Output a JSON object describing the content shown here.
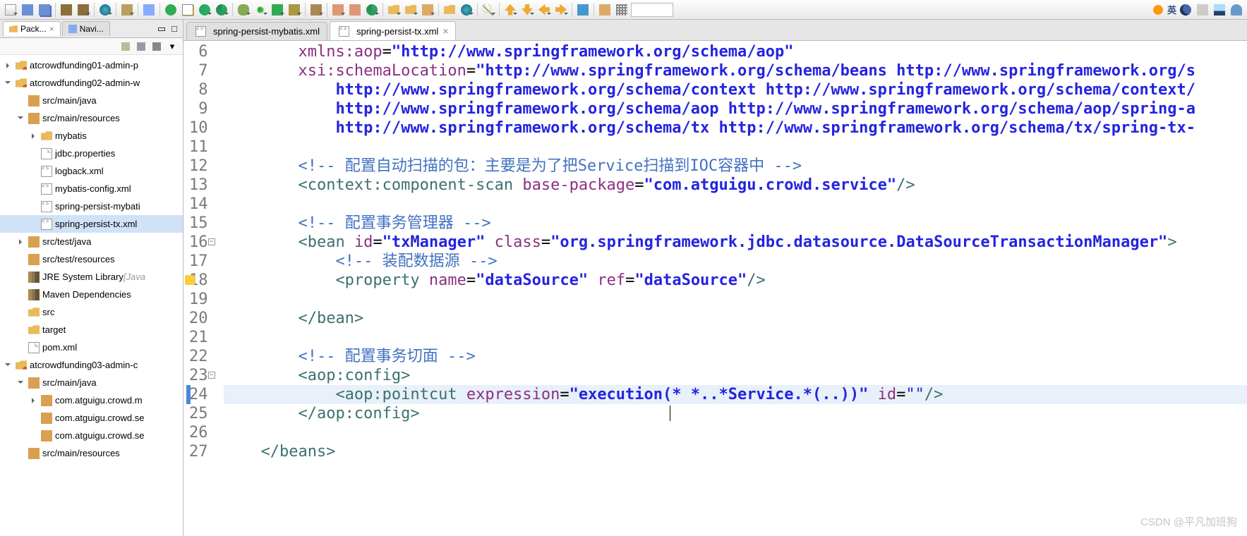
{
  "toolbar_right_text": "英",
  "sidebar": {
    "tabs": [
      {
        "label": "Pack...",
        "active": true
      },
      {
        "label": "Navi...",
        "active": false
      }
    ],
    "tree": [
      {
        "d": 0,
        "exp": "closed",
        "icon": "proj",
        "label": "atcrowdfunding01-admin-p"
      },
      {
        "d": 0,
        "exp": "open",
        "icon": "proj",
        "label": "atcrowdfunding02-admin-w"
      },
      {
        "d": 1,
        "exp": "none",
        "icon": "pkg",
        "label": "src/main/java"
      },
      {
        "d": 1,
        "exp": "open",
        "icon": "pkg",
        "label": "src/main/resources"
      },
      {
        "d": 2,
        "exp": "closed",
        "icon": "fold",
        "label": "mybatis"
      },
      {
        "d": 2,
        "exp": "none",
        "icon": "file",
        "label": "jdbc.properties"
      },
      {
        "d": 2,
        "exp": "none",
        "icon": "xml",
        "label": "logback.xml"
      },
      {
        "d": 2,
        "exp": "none",
        "icon": "xml",
        "label": "mybatis-config.xml"
      },
      {
        "d": 2,
        "exp": "none",
        "icon": "xml",
        "label": "spring-persist-mybati"
      },
      {
        "d": 2,
        "exp": "none",
        "icon": "xml",
        "label": "spring-persist-tx.xml",
        "sel": true
      },
      {
        "d": 1,
        "exp": "closed",
        "icon": "pkg",
        "label": "src/test/java"
      },
      {
        "d": 1,
        "exp": "none",
        "icon": "pkg",
        "label": "src/test/resources"
      },
      {
        "d": 1,
        "exp": "none",
        "icon": "lib",
        "label": "JRE System Library",
        "decor": " [Java"
      },
      {
        "d": 1,
        "exp": "none",
        "icon": "lib",
        "label": "Maven Dependencies"
      },
      {
        "d": 1,
        "exp": "none",
        "icon": "fold",
        "label": "src"
      },
      {
        "d": 1,
        "exp": "none",
        "icon": "fold",
        "label": "target"
      },
      {
        "d": 1,
        "exp": "none",
        "icon": "file",
        "label": "pom.xml"
      },
      {
        "d": 0,
        "exp": "open",
        "icon": "proj",
        "label": "atcrowdfunding03-admin-c"
      },
      {
        "d": 1,
        "exp": "open",
        "icon": "pkg",
        "label": "src/main/java"
      },
      {
        "d": 2,
        "exp": "closed",
        "icon": "pkg",
        "label": "com.atguigu.crowd.m"
      },
      {
        "d": 2,
        "exp": "none",
        "icon": "pkg",
        "label": "com.atguigu.crowd.se"
      },
      {
        "d": 2,
        "exp": "none",
        "icon": "pkg",
        "label": "com.atguigu.crowd.se"
      },
      {
        "d": 1,
        "exp": "none",
        "icon": "pkg",
        "label": "src/main/resources"
      }
    ]
  },
  "editor": {
    "tabs": [
      {
        "label": "spring-persist-mybatis.xml",
        "active": false
      },
      {
        "label": "spring-persist-tx.xml",
        "active": true
      }
    ],
    "startLine": 6,
    "lines": [
      {
        "n": 6,
        "seg": [
          {
            "c": "attr",
            "t": "        xmlns:aop"
          },
          {
            "c": "",
            "t": "="
          },
          {
            "c": "strb",
            "t": "\"http://www.springframework.org/schema/aop\""
          }
        ]
      },
      {
        "n": 7,
        "seg": [
          {
            "c": "attr",
            "t": "        xsi:schemaLocation"
          },
          {
            "c": "",
            "t": "="
          },
          {
            "c": "strb",
            "t": "\"http://www.springframework.org/schema/beans http://www.springframework.org/s"
          }
        ]
      },
      {
        "n": 8,
        "seg": [
          {
            "c": "strb",
            "t": "            http://www.springframework.org/schema/context http://www.springframework.org/schema/context/"
          }
        ]
      },
      {
        "n": 9,
        "seg": [
          {
            "c": "strb",
            "t": "            http://www.springframework.org/schema/aop http://www.springframework.org/schema/aop/spring-a"
          }
        ]
      },
      {
        "n": 10,
        "seg": [
          {
            "c": "strb",
            "t": "            http://www.springframework.org/schema/tx http://www.springframework.org/schema/tx/spring-tx-"
          }
        ]
      },
      {
        "n": 11,
        "seg": []
      },
      {
        "n": 12,
        "seg": [
          {
            "c": "cmt",
            "t": "        <!-- "
          },
          {
            "c": "cmt-txt",
            "t": "配置自动扫描的包：主要是为了把Service扫描到IOC容器中"
          },
          {
            "c": "cmt",
            "t": " -->"
          }
        ]
      },
      {
        "n": 13,
        "seg": [
          {
            "c": "tag",
            "t": "        <context:component-scan "
          },
          {
            "c": "attr",
            "t": "base-package"
          },
          {
            "c": "",
            "t": "="
          },
          {
            "c": "strb",
            "t": "\"com.atguigu.crowd.service\""
          },
          {
            "c": "tag",
            "t": "/>"
          }
        ]
      },
      {
        "n": 14,
        "seg": []
      },
      {
        "n": 15,
        "seg": [
          {
            "c": "cmt",
            "t": "        <!-- "
          },
          {
            "c": "cmt-txt",
            "t": "配置事务管理器"
          },
          {
            "c": "cmt",
            "t": " -->"
          }
        ]
      },
      {
        "n": 16,
        "fold": true,
        "seg": [
          {
            "c": "tag",
            "t": "        <bean "
          },
          {
            "c": "attr",
            "t": "id"
          },
          {
            "c": "",
            "t": "="
          },
          {
            "c": "strb",
            "t": "\"txManager\""
          },
          {
            "c": "tag",
            "t": " "
          },
          {
            "c": "attr",
            "t": "class"
          },
          {
            "c": "",
            "t": "="
          },
          {
            "c": "strb",
            "t": "\"org.springframework.jdbc.datasource.DataSourceTransactionManager\""
          },
          {
            "c": "tag",
            "t": ">"
          }
        ]
      },
      {
        "n": 17,
        "seg": [
          {
            "c": "cmt",
            "t": "            <!-- "
          },
          {
            "c": "cmt-txt",
            "t": "装配数据源"
          },
          {
            "c": "cmt",
            "t": " -->"
          }
        ]
      },
      {
        "n": 18,
        "warn": "y",
        "seg": [
          {
            "c": "tag",
            "t": "            <property "
          },
          {
            "c": "attr",
            "t": "name"
          },
          {
            "c": "",
            "t": "="
          },
          {
            "c": "strb",
            "t": "\"dataSource\""
          },
          {
            "c": "tag",
            "t": " "
          },
          {
            "c": "attr",
            "t": "ref"
          },
          {
            "c": "",
            "t": "="
          },
          {
            "c": "strb",
            "t": "\"dataSource\""
          },
          {
            "c": "tag",
            "t": "/>"
          }
        ]
      },
      {
        "n": 19,
        "seg": []
      },
      {
        "n": 20,
        "seg": [
          {
            "c": "tag",
            "t": "        </bean>"
          }
        ]
      },
      {
        "n": 21,
        "seg": []
      },
      {
        "n": 22,
        "seg": [
          {
            "c": "cmt",
            "t": "        <!-- "
          },
          {
            "c": "cmt-txt",
            "t": "配置事务切面"
          },
          {
            "c": "cmt",
            "t": " -->"
          }
        ]
      },
      {
        "n": 23,
        "fold": true,
        "seg": [
          {
            "c": "tag",
            "t": "        <aop:config>"
          }
        ]
      },
      {
        "n": 24,
        "cur": true,
        "hl": true,
        "seg": [
          {
            "c": "tag",
            "t": "            <aop:pointcut "
          },
          {
            "c": "attr",
            "t": "expression"
          },
          {
            "c": "",
            "t": "="
          },
          {
            "c": "strb",
            "t": "\"execution(* *..*Service.*(..))\""
          },
          {
            "c": "tag",
            "t": " "
          },
          {
            "c": "attr",
            "t": "id"
          },
          {
            "c": "",
            "t": "="
          },
          {
            "c": "str",
            "t": "\"\""
          },
          {
            "c": "tag",
            "t": "/>"
          }
        ]
      },
      {
        "n": 25,
        "seg": [
          {
            "c": "tag",
            "t": "        </aop:config>"
          }
        ]
      },
      {
        "n": 26,
        "seg": []
      },
      {
        "n": 27,
        "seg": [
          {
            "c": "tag",
            "t": "    </beans>"
          }
        ]
      }
    ]
  },
  "watermark": "CSDN @平凡加班狗"
}
